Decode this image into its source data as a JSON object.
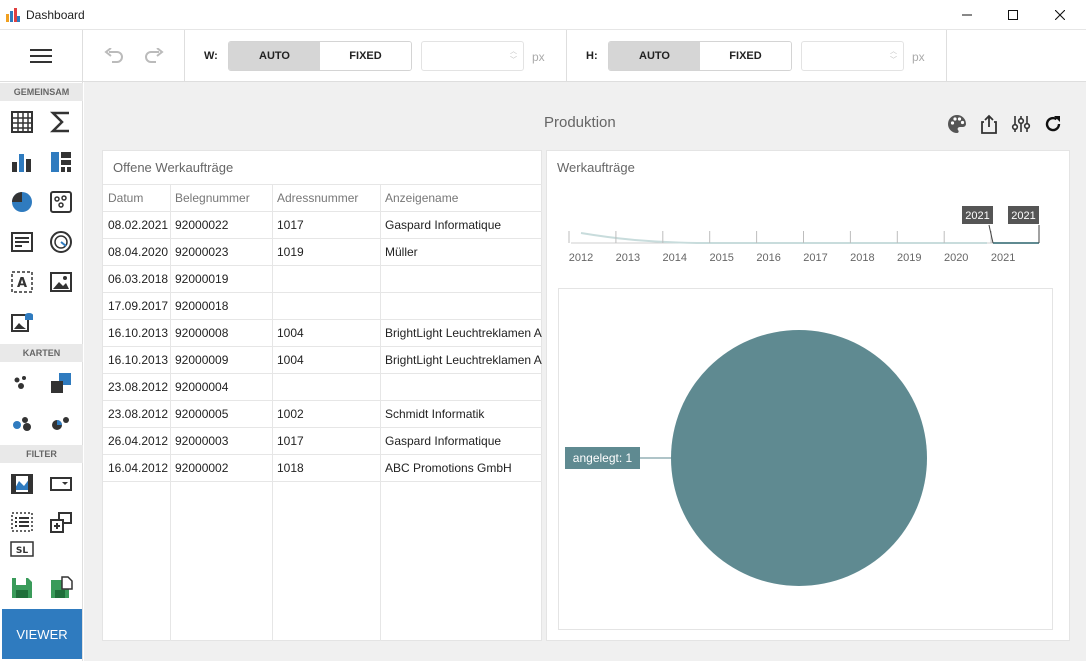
{
  "window": {
    "title": "Dashboard"
  },
  "toolbar": {
    "w_label": "W:",
    "h_label": "H:",
    "auto_label": "AUTO",
    "fixed_label": "FIXED",
    "unit_label": "px",
    "w_value": "",
    "h_value": ""
  },
  "sidebar": {
    "sections": [
      "GEMEINSAM",
      "KARTEN",
      "FILTER"
    ],
    "viewer_label": "VIEWER"
  },
  "dashboard": {
    "title": "Produktion"
  },
  "grid_panel": {
    "title": "Offene Werkaufträge",
    "columns": [
      "Datum",
      "Belegnummer",
      "Adressnummer",
      "Anzeigename"
    ],
    "rows": [
      [
        "08.02.2021",
        "92000022",
        "1017",
        "Gaspard Informatique"
      ],
      [
        "08.04.2020",
        "92000023",
        "1019",
        "Müller"
      ],
      [
        "06.03.2018",
        "92000019",
        "",
        ""
      ],
      [
        "17.09.2017",
        "92000018",
        "",
        ""
      ],
      [
        "16.10.2013",
        "92000008",
        "1004",
        "BrightLight Leuchtreklamen AG"
      ],
      [
        "16.10.2013",
        "92000009",
        "1004",
        "BrightLight Leuchtreklamen AG"
      ],
      [
        "23.08.2012",
        "92000004",
        "",
        ""
      ],
      [
        "23.08.2012",
        "92000005",
        "1002",
        "Schmidt Informatik"
      ],
      [
        "26.04.2012",
        "92000003",
        "1017",
        "Gaspard Informatique"
      ],
      [
        "16.04.2012",
        "92000002",
        "1018",
        "ABC Promotions GmbH"
      ]
    ]
  },
  "chart_panel": {
    "title": "Werkaufträge",
    "range_years": [
      "2012",
      "2013",
      "2014",
      "2015",
      "2016",
      "2017",
      "2018",
      "2019",
      "2020",
      "2021"
    ],
    "range_start_label": "2021",
    "range_end_label": "2021",
    "accent_color": "#5f8a91",
    "range_curve_color": "#c8dcdc"
  },
  "chart_data": {
    "type": "pie",
    "title": "",
    "slices": [
      {
        "label": "angelegt",
        "value": 1,
        "color": "#5f8a91"
      }
    ],
    "slice_labels": [
      "angelegt: 1"
    ]
  }
}
